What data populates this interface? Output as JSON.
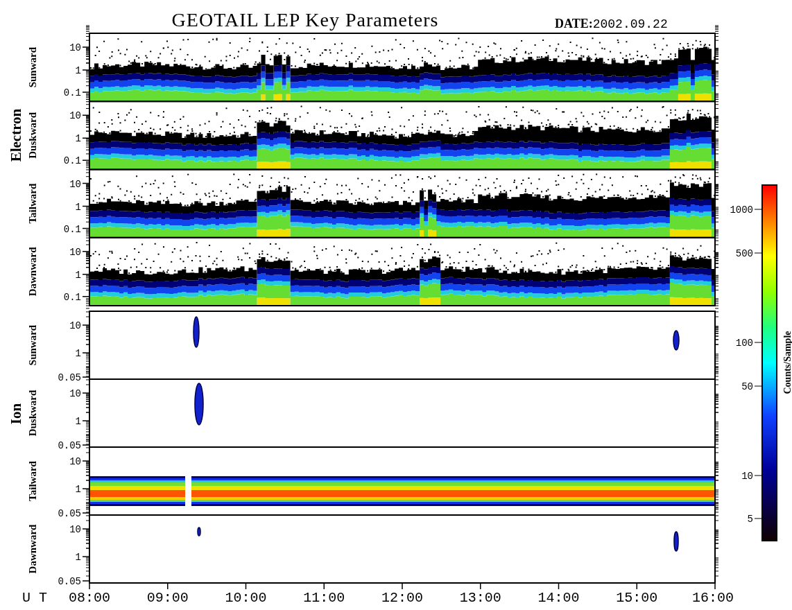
{
  "title": "GEOTAIL LEP Key Parameters",
  "date": {
    "label": "DATE:",
    "value": "2002.09.22"
  },
  "groups": [
    {
      "name": "Electron",
      "panels": [
        {
          "label": "Sunward",
          "kind": "electron",
          "yticks": [
            "10",
            "1",
            "0.1"
          ]
        },
        {
          "label": "Duskward",
          "kind": "electron",
          "yticks": [
            "10",
            "1",
            "0.1"
          ]
        },
        {
          "label": "Tailward",
          "kind": "electron",
          "yticks": [
            "10",
            "1",
            "0.1"
          ]
        },
        {
          "label": "Dawnward",
          "kind": "electron",
          "yticks": [
            "10",
            "1",
            "0.1"
          ]
        }
      ]
    },
    {
      "name": "Ion",
      "panels": [
        {
          "label": "Sunward",
          "kind": "ion_sparse",
          "yticks": [
            "10",
            "1",
            "0.05"
          ]
        },
        {
          "label": "Duskward",
          "kind": "ion_sparse",
          "yticks": [
            "10",
            "1",
            "0.05"
          ]
        },
        {
          "label": "Tailward",
          "kind": "ion_band",
          "yticks": [
            "10",
            "1",
            "0.05"
          ]
        },
        {
          "label": "Dawnward",
          "kind": "ion_sparse",
          "yticks": [
            "10",
            "1",
            "0.05"
          ]
        }
      ]
    }
  ],
  "x_axis": {
    "label": "U T",
    "ticks": [
      "08:00",
      "09:00",
      "10:00",
      "11:00",
      "12:00",
      "13:00",
      "14:00",
      "15:00",
      "16:00"
    ]
  },
  "colorbar": {
    "label": "Counts/Sample",
    "ticks": [
      "1000",
      "500",
      "100",
      "50",
      "10",
      "5"
    ]
  }
}
